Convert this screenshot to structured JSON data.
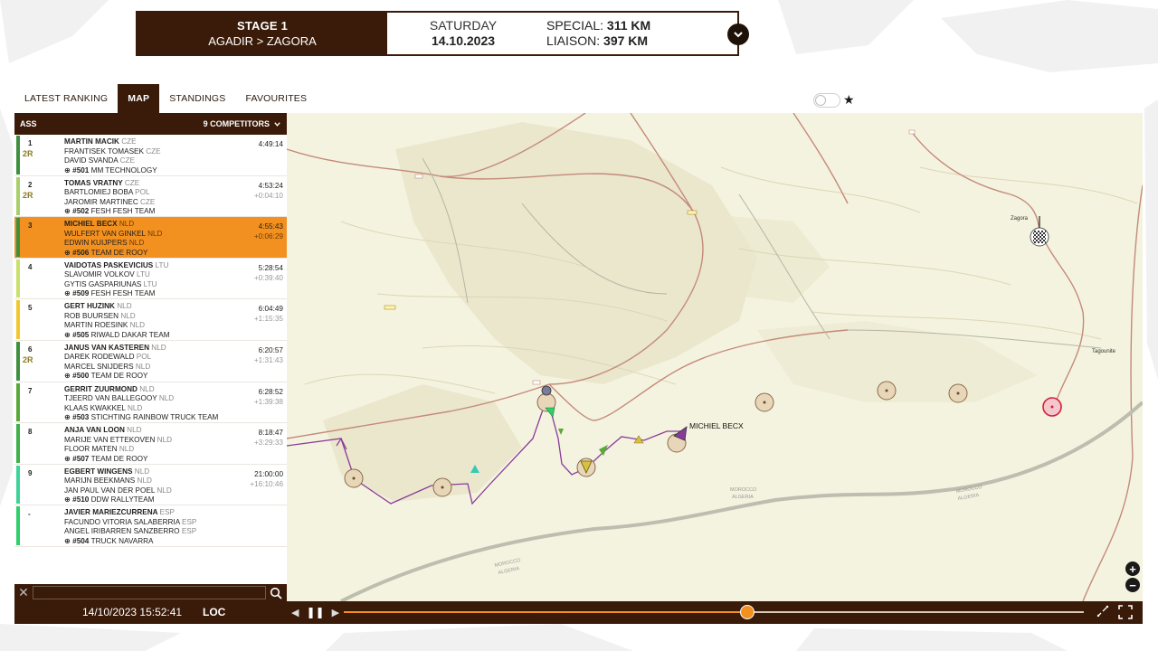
{
  "stage": {
    "title": "STAGE 1",
    "route": "AGADIR > ZAGORA",
    "day": "SATURDAY",
    "date": "14.10.2023",
    "special_label": "SPECIAL:",
    "special_value": "311 KM",
    "liaison_label": "LIAISON:",
    "liaison_value": "397 KM"
  },
  "tabs": [
    {
      "label": "LATEST RANKING",
      "active": false
    },
    {
      "label": "MAP",
      "active": true
    },
    {
      "label": "STANDINGS",
      "active": false
    },
    {
      "label": "FAVOURITES",
      "active": false
    }
  ],
  "panel": {
    "category": "ASS",
    "competitors_label": "9 COMPETITORS"
  },
  "competitors": [
    {
      "rank": "1",
      "badge": "2R",
      "bar": "#3f8f3f",
      "driver": "MARTIN MACIK",
      "driver_nat": "CZE",
      "crew1": "FRANTISEK TOMASEK",
      "crew1_nat": "CZE",
      "crew2": "DAVID SVANDA",
      "crew2_nat": "CZE",
      "team_no": "#501",
      "team": "MM TECHNOLOGY",
      "time": "4:49:14",
      "gap": ""
    },
    {
      "rank": "2",
      "badge": "2R",
      "bar": "#a8cf6a",
      "driver": "TOMAS VRATNY",
      "driver_nat": "CZE",
      "crew1": "BARTLOMIEJ BOBA",
      "crew1_nat": "POL",
      "crew2": "JAROMIR MARTINEC",
      "crew2_nat": "CZE",
      "team_no": "#502",
      "team": "FESH FESH TEAM",
      "time": "4:53:24",
      "gap": "+0:04:10"
    },
    {
      "rank": "3",
      "badge": "",
      "bar": "#3f8f3f",
      "driver": "MICHIEL BECX",
      "driver_nat": "NLD",
      "crew1": "WULFERT VAN GINKEL",
      "crew1_nat": "NLD",
      "crew2": "EDWIN KUIJPERS",
      "crew2_nat": "NLD",
      "team_no": "#506",
      "team": "TEAM DE ROOY",
      "time": "4:55:43",
      "gap": "+0:06:29",
      "selected": true
    },
    {
      "rank": "4",
      "badge": "",
      "bar": "#c9e06a",
      "driver": "VAIDOTAS PASKEVICIUS",
      "driver_nat": "LTU",
      "crew1": "SLAVOMIR VOLKOV",
      "crew1_nat": "LTU",
      "crew2": "GYTIS GASPARIUNAS",
      "crew2_nat": "LTU",
      "team_no": "#509",
      "team": "FESH FESH TEAM",
      "time": "5:28:54",
      "gap": "+0:39:40"
    },
    {
      "rank": "5",
      "badge": "",
      "bar": "#f1c82a",
      "driver": "GERT HUZINK",
      "driver_nat": "NLD",
      "crew1": "ROB BUURSEN",
      "crew1_nat": "NLD",
      "crew2": "MARTIN ROESINK",
      "crew2_nat": "NLD",
      "team_no": "#505",
      "team": "RIWALD DAKAR TEAM",
      "time": "6:04:49",
      "gap": "+1:15:35"
    },
    {
      "rank": "6",
      "badge": "2R",
      "bar": "#3f8f3f",
      "driver": "JANUS VAN KASTEREN",
      "driver_nat": "NLD",
      "crew1": "DAREK RODEWALD",
      "crew1_nat": "POL",
      "crew2": "MARCEL SNIJDERS",
      "crew2_nat": "NLD",
      "team_no": "#500",
      "team": "TEAM DE ROOY",
      "time": "6:20:57",
      "gap": "+1:31:43"
    },
    {
      "rank": "7",
      "badge": "",
      "bar": "#5aa83a",
      "driver": "GERRIT ZUURMOND",
      "driver_nat": "NLD",
      "crew1": "TJEERD VAN BALLEGOOY",
      "crew1_nat": "NLD",
      "crew2": "KLAAS KWAKKEL",
      "crew2_nat": "NLD",
      "team_no": "#503",
      "team": "STICHTING RAINBOW TRUCK TEAM",
      "time": "6:28:52",
      "gap": "+1:39:38"
    },
    {
      "rank": "8",
      "badge": "",
      "bar": "#3fb04a",
      "driver": "ANJA VAN LOON",
      "driver_nat": "NLD",
      "crew1": "MARIJE VAN ETTEKOVEN",
      "crew1_nat": "NLD",
      "crew2": "FLOOR MATEN",
      "crew2_nat": "NLD",
      "team_no": "#507",
      "team": "TEAM DE ROOY",
      "time": "8:18:47",
      "gap": "+3:29:33"
    },
    {
      "rank": "9",
      "badge": "",
      "bar": "#3ed39a",
      "driver": "EGBERT WINGENS",
      "driver_nat": "NLD",
      "crew1": "MARIJN BEEKMANS",
      "crew1_nat": "NLD",
      "crew2": "JAN PAUL VAN DER POEL",
      "crew2_nat": "NLD",
      "team_no": "#510",
      "team": "DDW RALLYTEAM",
      "time": "21:00:00",
      "gap": "+16:10:46"
    },
    {
      "rank": "-",
      "badge": "",
      "bar": "#2fcf6a",
      "driver": "JAVIER MARIEZCURRENA",
      "driver_nat": "ESP",
      "crew1": "FACUNDO VITORIA SALABERRIA",
      "crew1_nat": "ESP",
      "crew2": "ANGEL IRIBARREN SANZBERRO",
      "crew2_nat": "ESP",
      "team_no": "#504",
      "team": "TRUCK NAVARRA",
      "time": "",
      "gap": ""
    }
  ],
  "search": {
    "placeholder": "",
    "value": ""
  },
  "map": {
    "labels": {
      "zagora": "Zagora",
      "tagounite": "Tagounite",
      "competitor": "MICHIEL BECX",
      "border1": "MOROCCO",
      "border2": "ALGERIA",
      "border3": "MOROCCO",
      "border4": "ALGERIA",
      "border5": "MOROCCO",
      "border6": "ALGERIA"
    },
    "colors": {
      "track": "#8a3a9a",
      "road": "#c48a7a",
      "selected": "#f39120"
    }
  },
  "playback": {
    "datetime": "14/10/2023 15:52:41",
    "mode": "LOC",
    "progress": 0.545
  }
}
